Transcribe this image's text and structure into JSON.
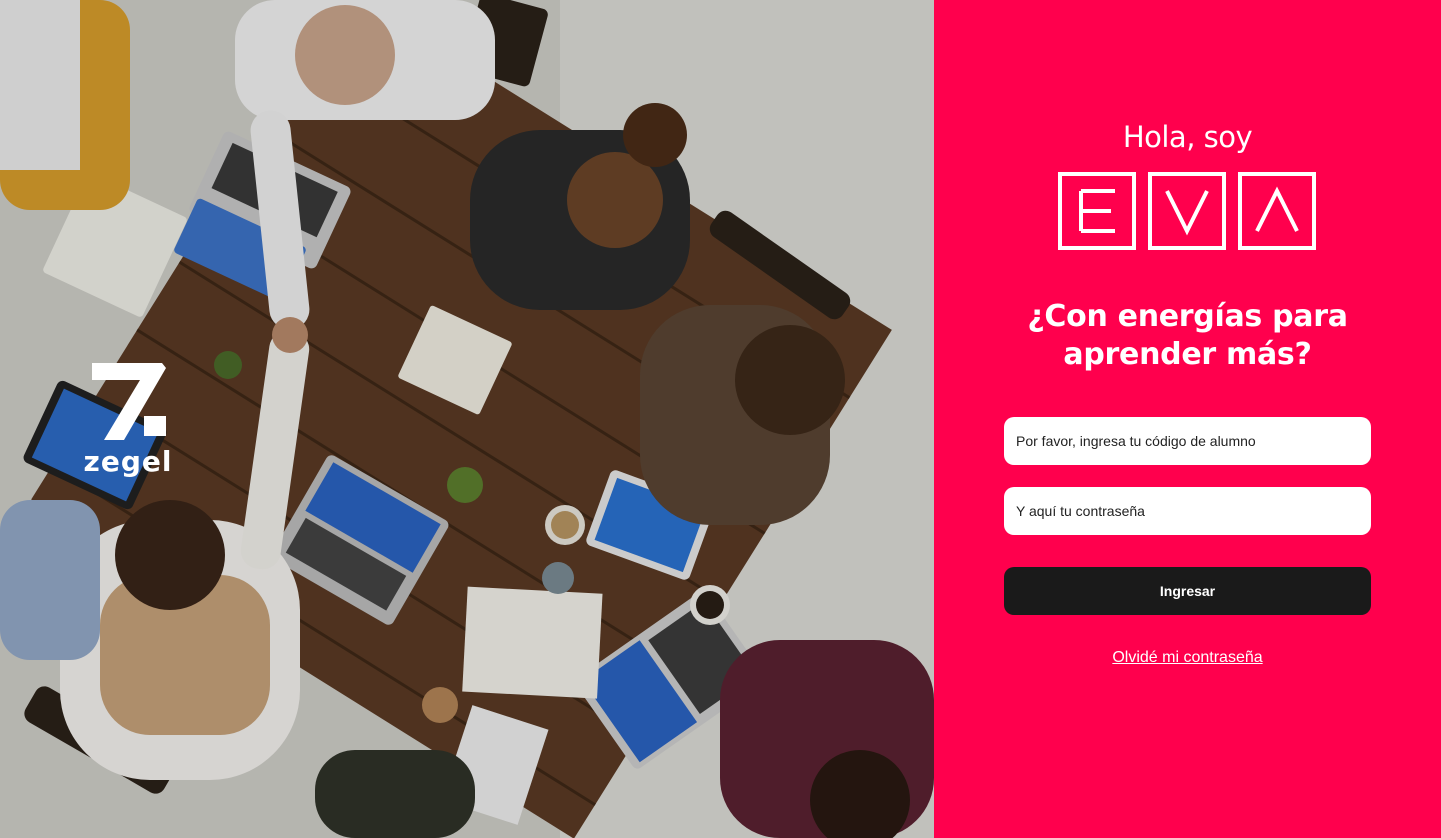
{
  "brand": {
    "name": "ZEGEL",
    "wordmark": "zegel",
    "logo_icon": "zegel-seven-logo"
  },
  "login": {
    "greeting": "Hola, soy",
    "product_logo": [
      "E",
      "V",
      "Λ"
    ],
    "headline_line1": "¿Con energías para",
    "headline_line2": "aprender más?",
    "student_code_placeholder": "Por favor, ingresa tu código de alumno",
    "password_placeholder": "Y aquí tu contraseña",
    "submit_label": "Ingresar",
    "forgot_password_label": "Olvidé mi contraseña"
  },
  "colors": {
    "brand_pink": "#ff004d",
    "button_dark": "#1a1a1a",
    "white": "#ffffff"
  }
}
